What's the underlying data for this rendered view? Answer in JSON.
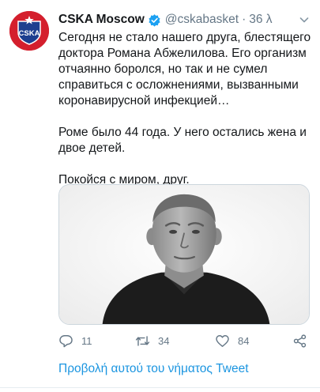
{
  "account": {
    "display_name": "CSKA Moscow",
    "handle": "@cskabasket",
    "separator": "·",
    "time": "36 λ",
    "avatar_text": "CSKA"
  },
  "tweet": {
    "paragraphs": [
      "Сегодня не стало нашего друга, блестящего доктора Романа Абжелилова. Его организм отчаянно боролся, но так и не сумел справиться с осложнениями, вызванными коронавирусной инфекцией…",
      "Роме было 44 года. У него остались жена и двое детей.",
      "Покойся с миром, друг."
    ]
  },
  "actions": {
    "replies": "11",
    "retweets": "34",
    "likes": "84"
  },
  "translate_label": "Προβολή αυτού του νήματος Tweet",
  "colors": {
    "link": "#1b95e0",
    "muted": "#657786",
    "avatar_red": "#d41f2d",
    "verified_blue": "#1da1f2"
  }
}
